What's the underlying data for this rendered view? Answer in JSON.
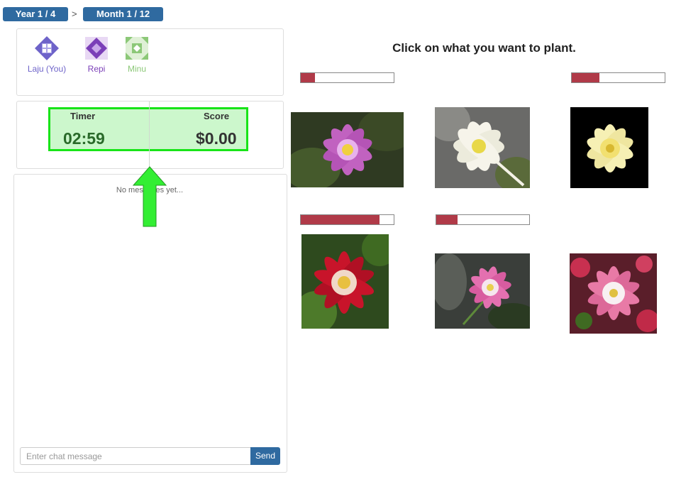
{
  "breadcrumb": {
    "year": "Year 1 / 4",
    "separator": ">",
    "month": "Month 1 / 12"
  },
  "players": [
    {
      "name": "Laju (You)",
      "color": "#6e63c9",
      "icon": "player-avatar-icon"
    },
    {
      "name": "Repi",
      "color": "#7b3fb8",
      "icon": "player-avatar-icon"
    },
    {
      "name": "Minu",
      "color": "#8cc878",
      "icon": "player-avatar-icon"
    }
  ],
  "timer": {
    "label": "Timer",
    "value": "02:59"
  },
  "score": {
    "label": "Score",
    "value": "$0.00"
  },
  "highlight": {
    "box_color": "#18e418",
    "arrow_color": "#33ee33"
  },
  "chat": {
    "empty_text": "No messages yet...",
    "placeholder": "Enter chat message",
    "send_label": "Send"
  },
  "main": {
    "instruction": "Click on what you want to plant.",
    "accent_color": "#b03a48",
    "flowers": [
      {
        "name": "purple columbine",
        "progress": 0.15
      },
      {
        "name": "white columbine",
        "progress": null
      },
      {
        "name": "yellow columbine",
        "progress": 0.3
      },
      {
        "name": "red columbine",
        "progress": 0.85
      },
      {
        "name": "pink columbine",
        "progress": 0.23
      },
      {
        "name": "pink-white columbine",
        "progress": null
      }
    ]
  }
}
